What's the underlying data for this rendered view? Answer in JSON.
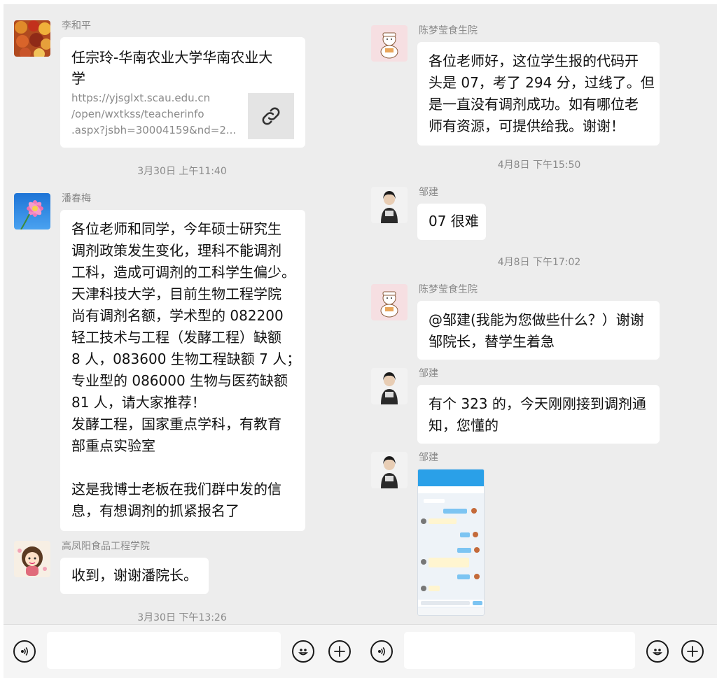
{
  "left": {
    "messages": [
      {
        "sender": "李和平",
        "type": "link",
        "link_title_lines": [
          "任宗玲-华南农业大学华南农业大",
          "学"
        ],
        "link_url_lines": [
          "https://yjsglxt.scau.edu.cn",
          "/open/wxtkss/teacherinfo",
          ".aspx?jsbh=30004159&nd=2..."
        ]
      },
      {
        "time": "3月30日 上午11:40"
      },
      {
        "sender": "潘春梅",
        "type": "text",
        "lines": [
          "各位老师和同学，今年硕士研究生",
          "调剂政策发生变化，理科不能调剂",
          "工科，造成可调剂的工科学生偏少。",
          "天津科技大学，目前生物工程学院",
          "尚有调剂名额，学术型的 082200",
          "轻工技术与工程（发酵工程）缺额",
          "8 人，083600 生物工程缺额 7 人；",
          "专业型的 086000 生物与医药缺额",
          "81 人，请大家推荐！",
          "发酵工程，国家重点学科，有教育",
          "部重点实验室",
          "",
          "这是我博士老板在我们群中发的信",
          "息，有想调剂的抓紧报名了"
        ]
      },
      {
        "sender": "高凤阳食品工程学院",
        "type": "text",
        "lines": [
          "收到，谢谢潘院长。"
        ]
      },
      {
        "time": "3月30日 下午13:26"
      }
    ]
  },
  "right": {
    "messages": [
      {
        "sender": "陈梦莹食生院",
        "type": "text",
        "lines": [
          "各位老师好，这位学生报的代码开",
          "头是 07，考了 294 分，过线了。但",
          "是一直没有调剂成功。如有哪位老",
          "师有资源，可提供给我。谢谢！"
        ]
      },
      {
        "time": "4月8日 下午15:50"
      },
      {
        "sender": "邹建",
        "type": "text",
        "lines": [
          "07 很难"
        ]
      },
      {
        "time": "4月8日 下午17:02"
      },
      {
        "sender": "陈梦莹食生院",
        "type": "text",
        "lines": [
          "@邹建(我能为您做些什么？）谢谢",
          "邹院长，替学生着急"
        ]
      },
      {
        "sender": "邹建",
        "type": "text",
        "lines": [
          "有个 323 的，今天刚刚接到调剂通",
          "知，您懂的"
        ]
      },
      {
        "sender": "邹建",
        "type": "image"
      }
    ]
  },
  "icons": {
    "voice": "voice-icon",
    "emoji": "emoji-icon",
    "plus": "plus-icon",
    "link": "link-icon"
  },
  "colors": {
    "background": "#ededed",
    "bubble": "#ffffff",
    "meta_text": "#8a8a8a"
  }
}
